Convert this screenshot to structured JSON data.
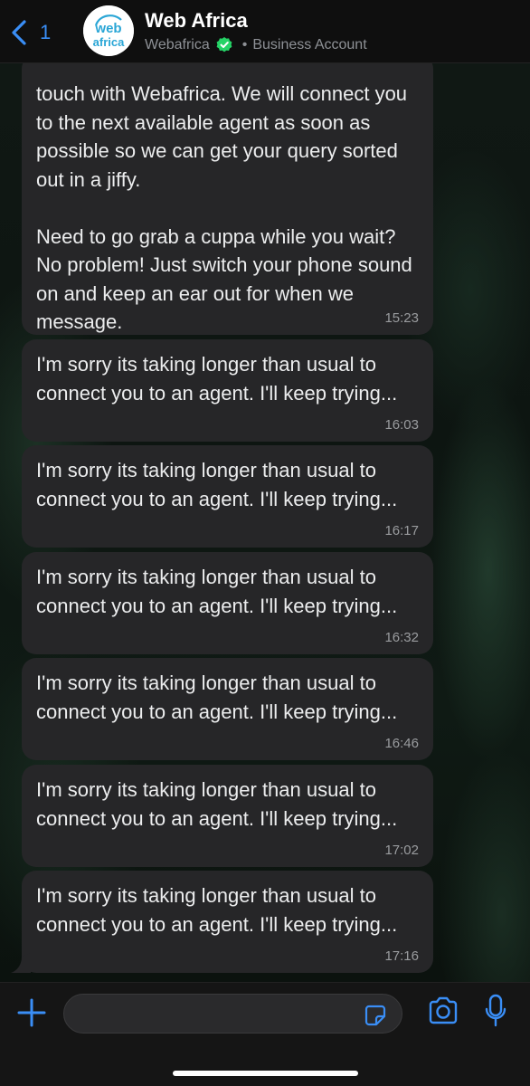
{
  "header": {
    "back_count": "1",
    "title": "Web Africa",
    "subtitle_name": "Webafrica",
    "subtitle_type": "Business Account",
    "avatar_text_line1": "web",
    "avatar_text_line2": "africa"
  },
  "messages": [
    {
      "text": "touch with Webafrica. We will connect you to the next available agent as soon as possible so we can get your query sorted out in a jiffy.\n\nNeed to go grab a cuppa while you wait? No problem! Just switch your phone sound on and keep an ear out for when we message.",
      "time": "15:23"
    },
    {
      "text": "I'm sorry its taking longer than usual to connect you to an agent. I'll keep trying...",
      "time": "16:03"
    },
    {
      "text": "I'm sorry its taking longer than usual to connect you to an agent. I'll keep trying...",
      "time": "16:17"
    },
    {
      "text": "I'm sorry its taking longer than usual to connect you to an agent. I'll keep trying...",
      "time": "16:32"
    },
    {
      "text": "I'm sorry its taking longer than usual to connect you to an agent. I'll keep trying...",
      "time": "16:46"
    },
    {
      "text": "I'm sorry its taking longer than usual to connect you to an agent. I'll keep trying...",
      "time": "17:02"
    },
    {
      "text": "I'm sorry its taking longer than usual to connect you to an agent. I'll keep trying...",
      "time": "17:16"
    }
  ],
  "composer": {
    "placeholder": "",
    "icons": [
      "plus-icon",
      "sticker-icon",
      "camera-icon",
      "microphone-icon"
    ]
  },
  "colors": {
    "accent": "#3a8ef6",
    "bubble": "#262628",
    "verified": "#25d366"
  }
}
